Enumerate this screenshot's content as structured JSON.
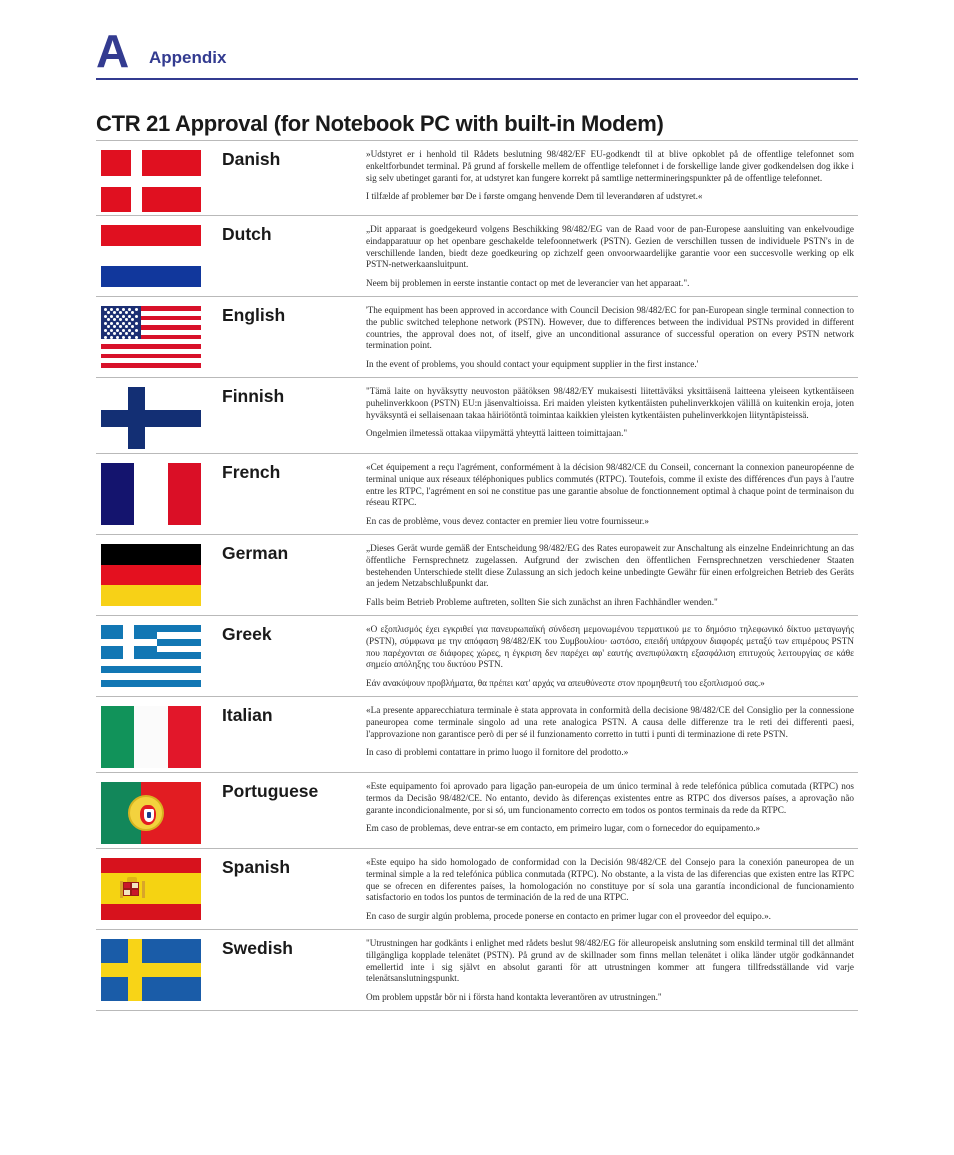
{
  "header": {
    "appendix_letter": "A",
    "appendix_label": "Appendix",
    "accent_color": "#333b90"
  },
  "page_title": "CTR 21 Approval (for Notebook PC with built-in Modem)",
  "languages": [
    {
      "name": "Danish",
      "flag": "denmark-flag",
      "paragraphs": [
        "»Udstyret er i henhold til Rådets beslutning 98/482/EF EU-godkendt til at blive opkoblet på de offentlige telefonnet som enkeltforbundet terminal. På grund af forskelle mellem de offentlige telefonnet i de forskellige lande giver godkendelsen dog ikke i sig selv ubetinget garanti for, at udstyret kan fungere korrekt på samtlige nettermineringspunkter på de offentlige telefonnet.",
        "I tilfælde af problemer bør De i første omgang henvende Dem til leverandøren af udstyret.«"
      ]
    },
    {
      "name": "Dutch",
      "flag": "netherlands-flag",
      "paragraphs": [
        "„Dit apparaat is goedgekeurd volgens Beschikking 98/482/EG van de Raad voor de pan-Europese aansluiting van enkelvoudige eindapparatuur op het openbare geschakelde telefoonnetwerk (PSTN). Gezien de verschillen tussen de individuele PSTN's in de verschillende landen, biedt deze goedkeuring op zichzelf geen onvoorwaardelijke garantie voor een succesvolle werking op elk PSTN-netwerkaansluitpunt.",
        "Neem bij problemen in eerste instantie contact op met de leverancier van het apparaat.\"."
      ]
    },
    {
      "name": "English",
      "flag": "usa-flag",
      "paragraphs": [
        "'The equipment has been approved in accordance with Council Decision 98/482/EC for pan-European single terminal connection to the public switched telephone network (PSTN). However, due to differences between the individual PSTNs provided in different countries, the approval does not, of itself, give an unconditional assurance of successful operation on every PSTN network termination point.",
        "In the event of problems, you should contact your equipment supplier in the first instance.'"
      ]
    },
    {
      "name": "Finnish",
      "flag": "finland-flag",
      "paragraphs": [
        "\"Tämä laite on hyväksytty neuvoston päätöksen 98/482/EY mukaisesti liitettäväksi yksittäisenä laitteena yleiseen kytkentäiseen puhelinverkkoon (PSTN) EU:n jäsenvaltioissa. Eri maiden yleisten kytkentäisten puhelinverkkojen välillä on kuitenkin eroja, joten hyväksyntä ei sellaisenaan takaa häiriötöntä toimintaa kaikkien yleisten kytkentäisten puhelinverkkojen liityntäpisteissä.",
        "Ongelmien ilmetessä ottakaa viipymättä yhteyttä laitteen toimittajaan.\""
      ]
    },
    {
      "name": "French",
      "flag": "france-flag",
      "paragraphs": [
        "«Cet équipement a reçu l'agrément, conformément à la décision 98/482/CE du Conseil, concernant la connexion paneuropéenne de terminal unique aux réseaux téléphoniques publics commutés (RTPC). Toutefois, comme il existe des différences d'un pays à l'autre entre les RTPC, l'agrément en soi ne constitue pas une garantie absolue de fonctionnement optimal à chaque point de terminaison du réseau RTPC.",
        "En cas de problème, vous devez contacter en premier lieu votre fournisseur.»"
      ]
    },
    {
      "name": "German",
      "flag": "germany-flag",
      "paragraphs": [
        "„Dieses Gerät wurde gemäß der Entscheidung 98/482/EG des Rates europaweit zur Anschaltung als einzelne Endeinrichtung an das öffentliche Fernsprechnetz zugelassen. Aufgrund der zwischen den öffentlichen Fernsprechnetzen verschiedener Staaten bestehenden Unterschiede stellt diese Zulassung an sich jedoch keine unbedingte Gewähr für einen erfolgreichen Betrieb des Geräts an jedem Netzabschlußpunkt dar.",
        "Falls beim Betrieb Probleme auftreten, sollten Sie sich zunächst an ihren Fachhändler wenden.\""
      ]
    },
    {
      "name": "Greek",
      "flag": "greece-flag",
      "paragraphs": [
        "«Ο εξοπλισμός έχει εγκριθεί για πανευρωπαϊκή σύνδεση μεμονωμένου τερματικού με το δημόσιο τηλεφωνικό δίκτυο μεταγωγής (PSTN), σύμφωνα με την απόφαση 98/482/ΕΚ του Συμβουλίου· ωστόσο, επειδή υπάρχουν διαφορές μεταξύ των επιμέρους PSTN που παρέχονται σε διάφορες χώρες, η έγκριση δεν παρέχει αφ' εαυτής ανεπιφύλακτη εξασφάλιση επιτυχούς λειτουργίας σε κάθε σημείο απόληξης του δικτύου PSTN.",
        "Εάν ανακύψουν προβλήματα, θα πρέπει κατ' αρχάς να απευθύνεστε στον προμηθευτή του εξοπλισμού σας.»"
      ]
    },
    {
      "name": "Italian",
      "flag": "italy-flag",
      "paragraphs": [
        "«La presente apparecchiatura terminale è stata approvata in conformità della decisione 98/482/CE del Consiglio per la connessione paneuropea come terminale singolo ad una rete analogica PSTN. A causa delle differenze tra le reti dei differenti paesi, l'approvazione non garantisce però di per sé il funzionamento corretto in tutti i punti di terminazione di rete PSTN.",
        "In caso di problemi contattare in primo luogo il fornitore del prodotto.»"
      ]
    },
    {
      "name": "Portuguese",
      "flag": "portugal-flag",
      "paragraphs": [
        "«Este equipamento foi aprovado para ligação pan-europeia de um único terminal à rede telefónica pública comutada (RTPC) nos termos da Decisão 98/482/CE. No entanto, devido às diferenças existentes entre as RTPC dos diversos países, a aprovação não garante incondicionalmente, por si só, um funcionamento correcto em todos os pontos terminais da rede da RTPC.",
        "Em caso de problemas, deve entrar-se em contacto, em primeiro lugar, com o fornecedor do equipamento.»"
      ]
    },
    {
      "name": "Spanish",
      "flag": "spain-flag",
      "paragraphs": [
        "«Este equipo ha sido homologado de conformidad con la Decisión 98/482/CE del Consejo para la conexión paneuropea de un terminal simple a la red telefónica pública conmutada (RTPC). No obstante, a la vista de las diferencias que existen entre las RTPC que se ofrecen en diferentes países, la homologación no constituye por sí sola una garantía incondicional de funcionamiento satisfactorio en todos los puntos de terminación de la red de una RTPC.",
        "En caso de surgir algún problema, procede ponerse en contacto en primer lugar con el proveedor del equipo.»."
      ]
    },
    {
      "name": "Swedish",
      "flag": "sweden-flag",
      "paragraphs": [
        "\"Utrustningen har godkänts i enlighet med rådets beslut 98/482/EG för alleuropeisk anslutning som enskild terminal till det allmänt tillgängliga kopplade telenätet (PSTN). På grund av de skillnader som finns mellan telenätet i olika länder utgör godkännandet emellertid inte i sig självt en absolut garanti för att utrustningen kommer att fungera tillfredsställande vid varje telenätsanslutningspunkt.",
        "Om problem uppstår bör ni i första hand kontakta leverantören av utrustningen.\""
      ]
    }
  ]
}
